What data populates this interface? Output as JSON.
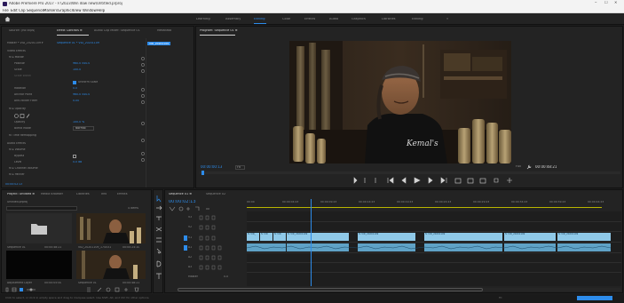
{
  "app": {
    "title": "Adobe Premiere Pro 2017 - F:\\2023\\Win dow new\\Untitled.prproj",
    "menu": [
      "File",
      "Edit",
      "Clip",
      "Sequence",
      "Markers",
      "Graphics",
      "View",
      "Window",
      "Help"
    ],
    "window_controls": [
      "–",
      "☐",
      "✕"
    ]
  },
  "workspaces": [
    "Learning",
    "Assembly",
    "Editing",
    "Color",
    "Effects",
    "Audio",
    "Graphics",
    "Libraries",
    "Editing",
    "»"
  ],
  "effect_controls": {
    "tabs": [
      "Source: (no clips)",
      "Effect Controls ≡",
      "Audio Clip Mixer: Sequence 01",
      "Metadata"
    ],
    "master": "Master * VID_20201109 ▾",
    "clip": "Sequence 01 * VID_20201109",
    "sections": [
      "Video Effects",
      "fx ▸ Motion",
      "Position",
      "Scale",
      "Scale Width",
      "Uniform Scale",
      "Rotation",
      "Anchor Point",
      "Anti-flicker Filter",
      "fx ▸ Opacity",
      "Opacity",
      "Blend Mode",
      "fx Time Remapping",
      "Audio Effects",
      "fx ▸ Volume",
      "Bypass",
      "Level",
      "fx ▸ Channel Volume",
      "fx ▸ Panner"
    ],
    "values": [
      "960.0  540.0",
      "100.0",
      "100.0",
      "0.0",
      "960.0  540.0",
      "0.00",
      "100.0 %",
      "Normal",
      "0.0 dB"
    ],
    "uniform_label": "Uniform Scale",
    "mini_clip": "VID_20201109",
    "timecode": "00:00:02:13"
  },
  "program": {
    "tab": "Program: Sequence 01 ≡",
    "timecode": "00:00:00:13",
    "fit": "Fit",
    "quality": "Full",
    "duration": "00:00:48:21",
    "shirt_text": "Kemal's"
  },
  "project": {
    "tabs": [
      "Project: Untitled ≡",
      "Media Browser",
      "Libraries",
      "Info",
      "Effects"
    ],
    "file": "Untitled.prproj",
    "count": "4 Items",
    "items": [
      {
        "name": "Sequence 01",
        "dur": "00:00:48:21"
      },
      {
        "name": "VID_20201109_174531",
        "dur": "00:00:24:10"
      },
      {
        "name": "Adjustment Layer",
        "dur": "00:00:05:00"
      },
      {
        "name": "Sequence 01",
        "dur": "00:00:48:21"
      }
    ]
  },
  "timeline": {
    "tab": "Sequence 01 ≡",
    "tab2": "Sequence 02",
    "timecode": "00:00:02:13",
    "ruler": [
      "00:00",
      "00:00:04:23",
      "00:00:09:23",
      "00:00:14:23",
      "00:00:19:23",
      "00:00:24:23",
      "00:00:29:23",
      "00:00:34:23",
      "00:00:39:23",
      "00:00:44:23"
    ],
    "tracks": [
      "V3",
      "V2",
      "V1",
      "A1",
      "A2",
      "A3",
      "Master"
    ],
    "master_value": "0.0",
    "clips": [
      "fx VID_",
      "fx VID",
      "fx VID",
      "fx VID_20201109",
      "fx VID_20201109",
      "fx VID_20201109",
      "fx VID_20201109",
      "fx VID_20201109"
    ]
  },
  "statusbar": {
    "text": "Click to select, or click in empty space and drag to marquee select. Use Shift, Alt, and Ctrl for other options.",
    "right": "Fit"
  },
  "colors": {
    "accent": "#2d8ceb",
    "playhead": "#2d8ceb",
    "video_clip": "#8fc9e8",
    "audio_clip": "#5fa2c6",
    "bg": "#1d1d1d",
    "panel": "#232323"
  }
}
